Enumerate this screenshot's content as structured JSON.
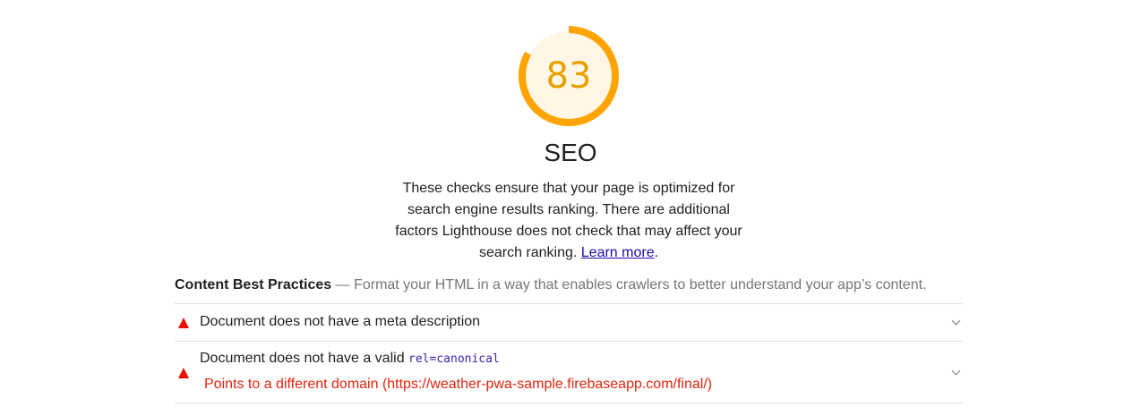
{
  "gauge": {
    "score": "83",
    "score_fraction": 0.83,
    "colors": {
      "arc": "#ffa400",
      "fill": "#fff6e5",
      "text": "#e8a000"
    }
  },
  "category": {
    "title": "SEO",
    "description": "These checks ensure that your page is optimized for search engine results ranking. There are additional factors Lighthouse does not check that may affect your search ranking.",
    "learn_more": "Learn more",
    "trailing_period": "."
  },
  "group": {
    "title": "Content Best Practices",
    "separator": " — ",
    "description": "Format your HTML in a way that enables crawlers to better understand your app’s content."
  },
  "audits": [
    {
      "title": "Document does not have a meta description",
      "status": "fail",
      "icon": "warning-triangle-icon"
    },
    {
      "title_prefix": "Document does not have a valid ",
      "title_code": "rel=canonical",
      "explanation": "Points to a different domain (https://weather-pwa-sample.firebaseapp.com/final/)",
      "status": "fail",
      "icon": "warning-triangle-icon"
    }
  ],
  "colors": {
    "fail": "#eb0f00",
    "link": "#1a0dab",
    "code": "#3f22b2"
  }
}
